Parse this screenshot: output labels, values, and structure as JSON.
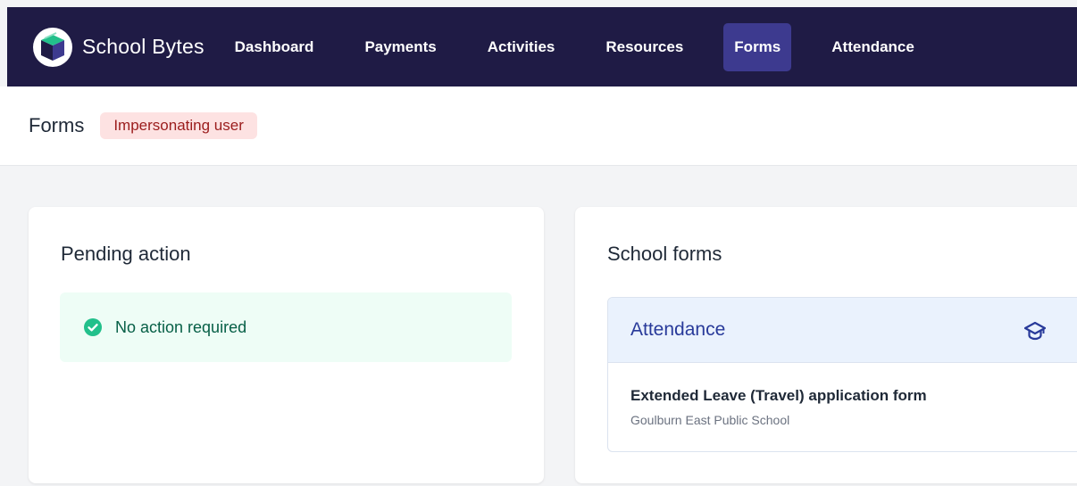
{
  "app": {
    "name": "School Bytes"
  },
  "nav": {
    "items": [
      {
        "label": "Dashboard"
      },
      {
        "label": "Payments"
      },
      {
        "label": "Activities"
      },
      {
        "label": "Resources"
      },
      {
        "label": "Forms",
        "active": true
      },
      {
        "label": "Attendance"
      }
    ]
  },
  "header": {
    "title": "Forms",
    "badge": "Impersonating user"
  },
  "pending": {
    "title": "Pending action",
    "message": "No action required",
    "icon": "check-circle-icon"
  },
  "school_forms": {
    "title": "School forms",
    "group": {
      "title": "Attendance",
      "icon": "graduation-cap-icon",
      "forms": [
        {
          "name": "Extended Leave (Travel) application form",
          "school": "Goulburn East Public School"
        }
      ]
    }
  },
  "colors": {
    "topbar": "#1f1b45",
    "nav_active": "#3d3a8f",
    "badge_bg": "#fde2e2",
    "badge_text": "#9b1c1c",
    "success": "#22c08b",
    "group_header": "#eaf2fd",
    "group_title": "#283a9a"
  }
}
